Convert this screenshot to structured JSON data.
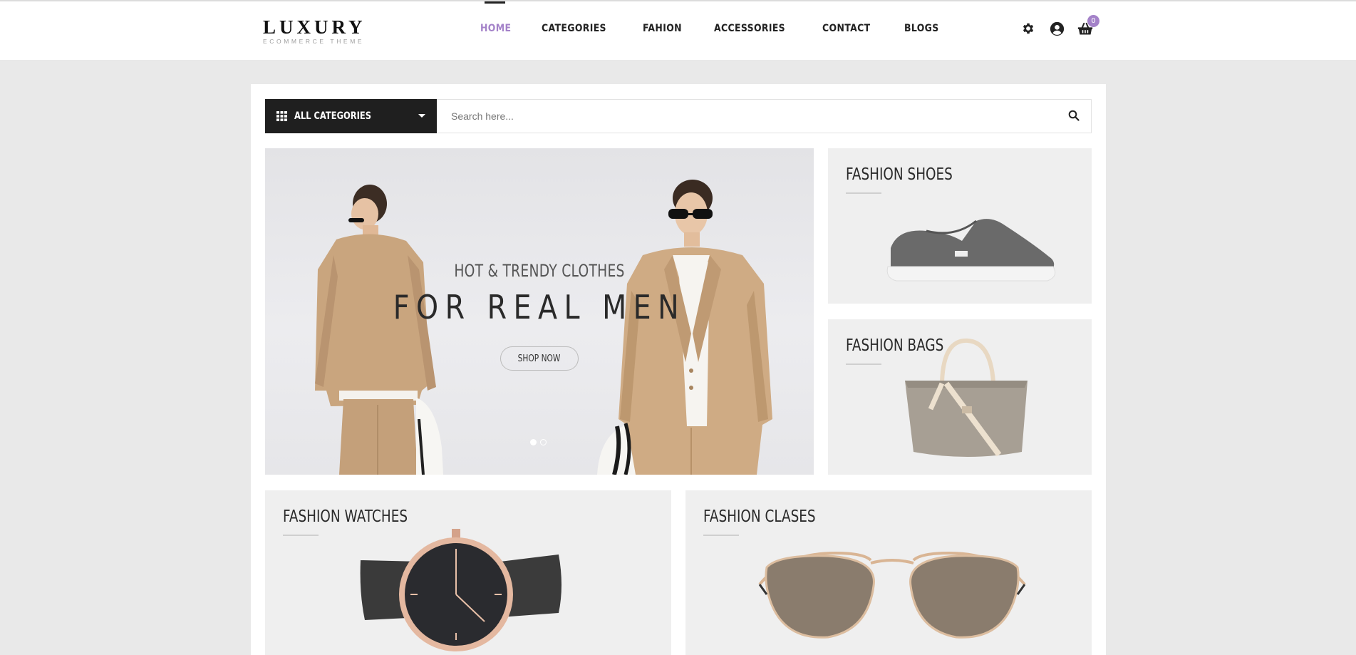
{
  "brand": {
    "name": "LUXURY",
    "tagline": "ECOMMERCE THEME"
  },
  "nav": {
    "items": [
      {
        "label": "HOME",
        "active": true
      },
      {
        "label": "CATEGORIES",
        "active": false
      },
      {
        "label": "FAHION",
        "active": false
      },
      {
        "label": "ACCESSORIES",
        "active": false
      },
      {
        "label": "CONTACT",
        "active": false
      },
      {
        "label": "BLOGS",
        "active": false
      }
    ]
  },
  "header_icons": {
    "settings": "gear-icon",
    "account": "user-circle-icon",
    "cart": "basket-icon",
    "cart_count": "0"
  },
  "search": {
    "category_label": "ALL CATEGORIES",
    "placeholder": "Search here..."
  },
  "hero": {
    "subtitle": "HOT & TRENDY CLOTHES",
    "title": "FOR REAL MEN",
    "button": "SHOP NOW",
    "slide_count": 2,
    "active_slide": 1
  },
  "tiles": {
    "shoes": "FASHION SHOES",
    "bags": "FASHION BAGS",
    "watches": "FASHION WATCHES",
    "glasses": "FASHION CLASES"
  },
  "colors": {
    "accent": "#a482c9",
    "dark": "#1f1f1f",
    "page_bg": "#e9e9e9"
  }
}
